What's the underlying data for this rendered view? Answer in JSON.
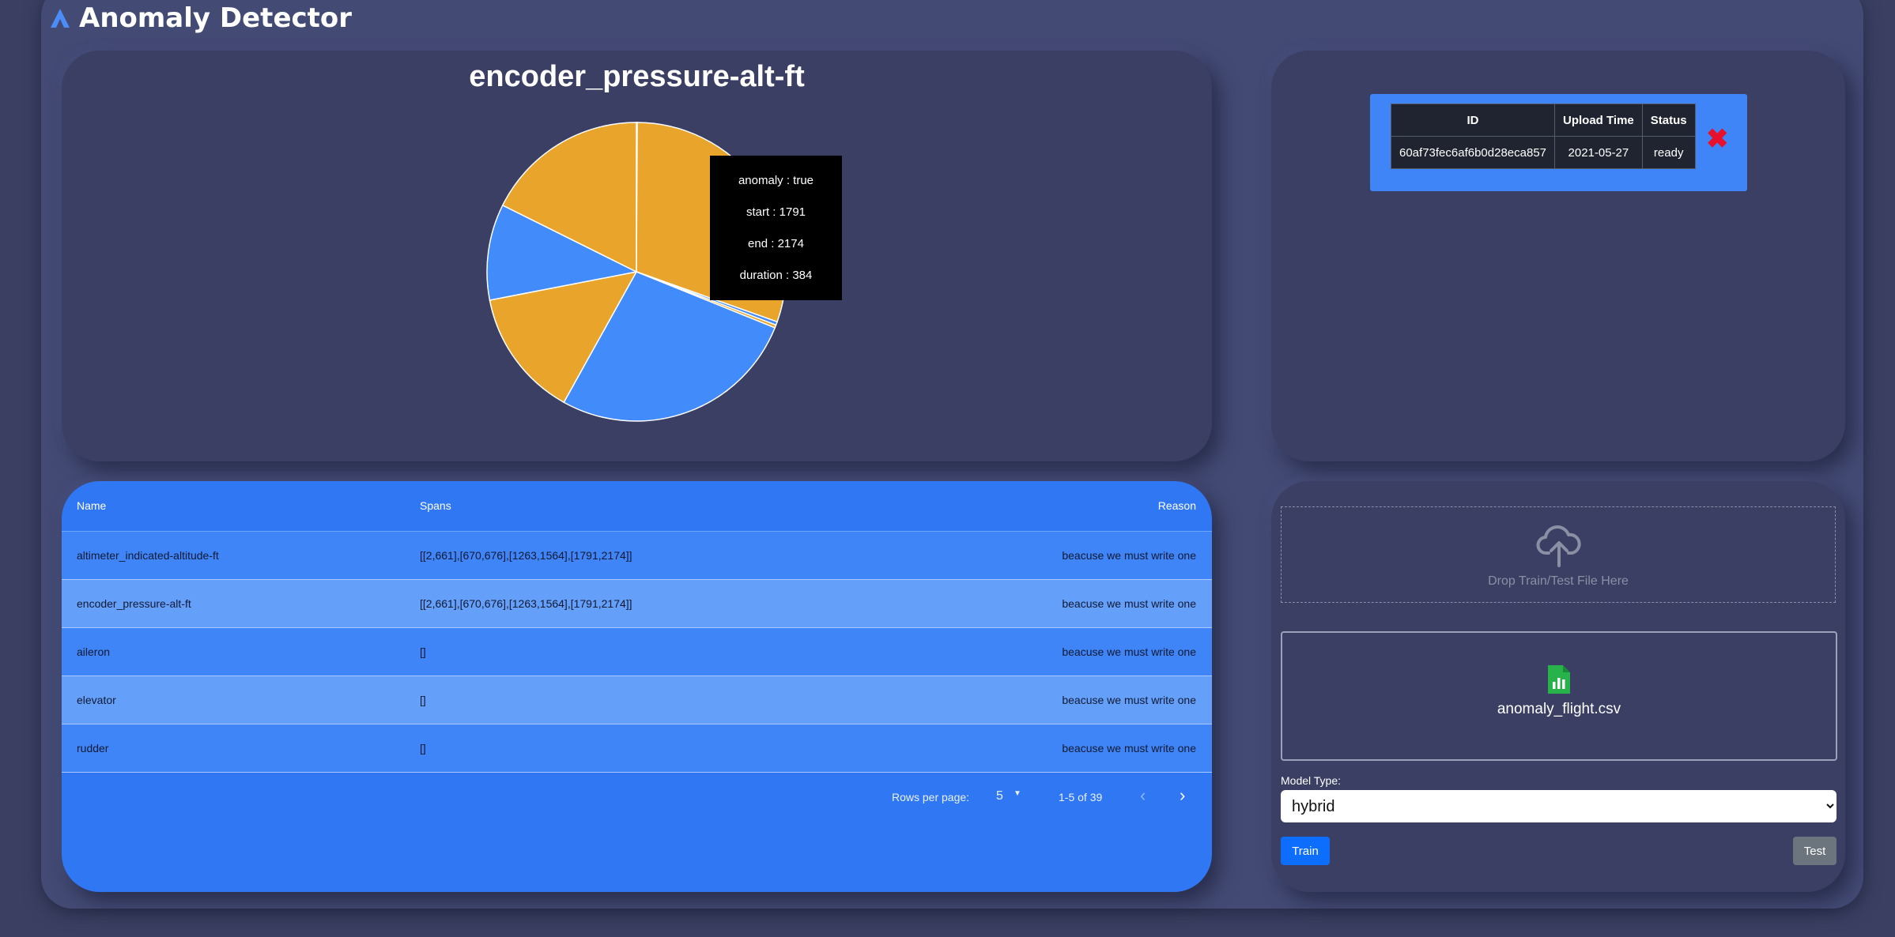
{
  "app": {
    "title": "Anomaly Detector"
  },
  "chart_data": {
    "type": "pie",
    "title": "encoder_pressure-alt-ft",
    "slices": [
      {
        "anomaly": "false",
        "start": 0,
        "end": 1,
        "duration": 2
      },
      {
        "anomaly": "true",
        "start": 2,
        "end": 661,
        "duration": 660
      },
      {
        "anomaly": "false",
        "start": 662,
        "end": 669,
        "duration": 8
      },
      {
        "anomaly": "true",
        "start": 670,
        "end": 676,
        "duration": 7
      },
      {
        "anomaly": "false",
        "start": 677,
        "end": 1262,
        "duration": 586
      },
      {
        "anomaly": "true",
        "start": 1263,
        "end": 1564,
        "duration": 302
      },
      {
        "anomaly": "false",
        "start": 1565,
        "end": 1790,
        "duration": 226
      },
      {
        "anomaly": "true",
        "start": 1791,
        "end": 2174,
        "duration": 384
      }
    ],
    "colors": {
      "anomaly": "#e9a42c",
      "normal": "#428bfa"
    }
  },
  "tooltip": {
    "anomaly": "anomaly : true",
    "start": "start : 1791",
    "end": "end : 2174",
    "duration": "duration : 384"
  },
  "files_table": {
    "headers": [
      "ID",
      "Upload Time",
      "Status"
    ],
    "rows": [
      {
        "id": "60af73fec6af6b0d28eca857",
        "upload_time": "2021-05-27",
        "status": "ready"
      }
    ],
    "delete_icon": "close-icon"
  },
  "anomaly_table": {
    "headers": {
      "name": "Name",
      "spans": "Spans",
      "reason": "Reason"
    },
    "rows": [
      {
        "name": "altimeter_indicated-altitude-ft",
        "spans": "[[2,661],[670,676],[1263,1564],[1791,2174]]",
        "reason": "beacuse we must write one"
      },
      {
        "name": "encoder_pressure-alt-ft",
        "spans": "[[2,661],[670,676],[1263,1564],[1791,2174]]",
        "reason": "beacuse we must write one"
      },
      {
        "name": "aileron",
        "spans": "[]",
        "reason": "beacuse we must write one"
      },
      {
        "name": "elevator",
        "spans": "[]",
        "reason": "beacuse we must write one"
      },
      {
        "name": "rudder",
        "spans": "[]",
        "reason": "beacuse we must write one"
      }
    ],
    "pagination": {
      "rows_per_page_label": "Rows per page:",
      "rows_per_page": "5",
      "range": "1-5 of 39"
    }
  },
  "upload": {
    "dropzone_label": "Drop Train/Test File Here",
    "file_name": "anomaly_flight.csv",
    "model_type_label": "Model Type:",
    "model_type_value": "hybrid",
    "train_label": "Train",
    "test_label": "Test"
  }
}
